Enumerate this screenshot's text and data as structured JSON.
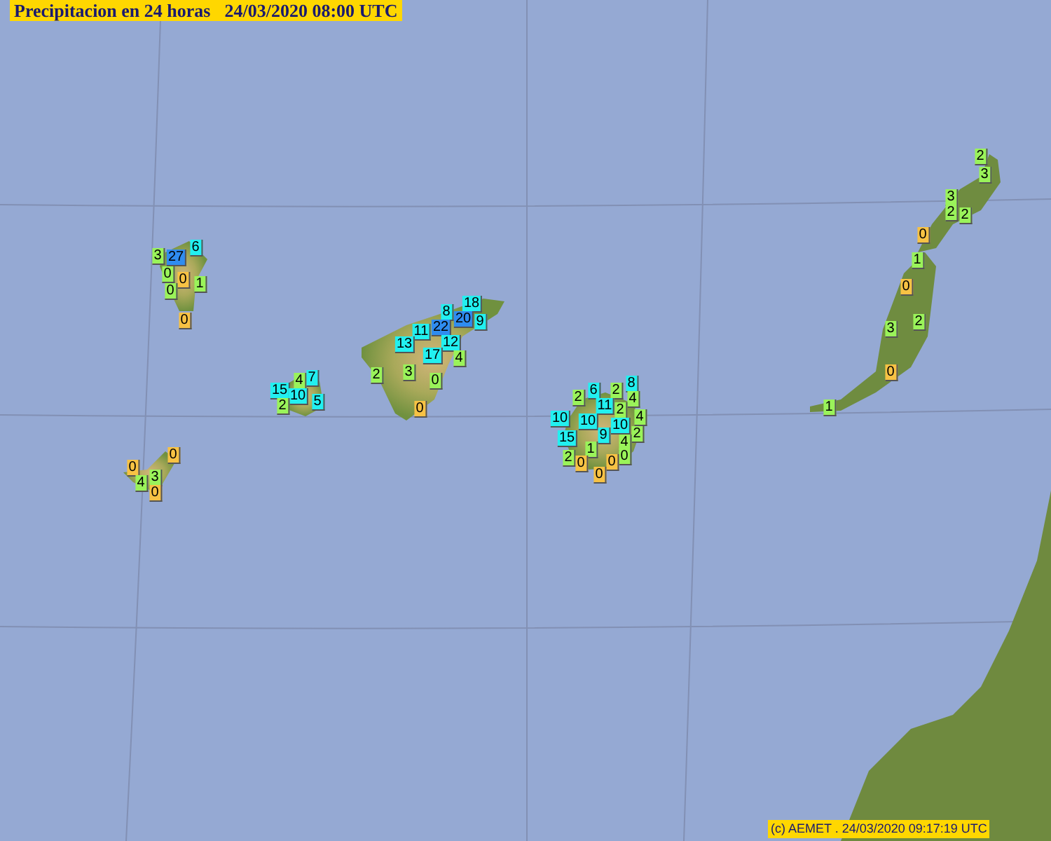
{
  "header": {
    "title": "Precipitacion en 24 horas",
    "timestamp": "24/03/2020 08:00 UTC"
  },
  "stations": [
    {
      "value": "3",
      "color": "#9af35a"
    },
    {
      "value": "27",
      "color": "#2f8cf0"
    },
    {
      "value": "6",
      "color": "#22f0f0"
    },
    {
      "value": "0",
      "color": "#9af35a"
    },
    {
      "value": "0",
      "color": "#f7c244"
    },
    {
      "value": "1",
      "color": "#9af35a"
    },
    {
      "value": "0",
      "color": "#9af35a"
    },
    {
      "value": "0",
      "color": "#f7c244"
    },
    {
      "value": "4",
      "color": "#9af35a"
    },
    {
      "value": "7",
      "color": "#22f0f0"
    },
    {
      "value": "15",
      "color": "#22f0f0"
    },
    {
      "value": "10",
      "color": "#22f0f0"
    },
    {
      "value": "2",
      "color": "#9af35a"
    },
    {
      "value": "5",
      "color": "#22f0f0"
    },
    {
      "value": "0",
      "color": "#f7c244"
    },
    {
      "value": "0",
      "color": "#f7c244"
    },
    {
      "value": "3",
      "color": "#9af35a"
    },
    {
      "value": "4",
      "color": "#9af35a"
    },
    {
      "value": "0",
      "color": "#f7c244"
    },
    {
      "value": "18",
      "color": "#22f0f0"
    },
    {
      "value": "8",
      "color": "#22f0f0"
    },
    {
      "value": "20",
      "color": "#2f8cf0"
    },
    {
      "value": "9",
      "color": "#22f0f0"
    },
    {
      "value": "11",
      "color": "#22f0f0"
    },
    {
      "value": "22",
      "color": "#2f8cf0"
    },
    {
      "value": "13",
      "color": "#22f0f0"
    },
    {
      "value": "12",
      "color": "#22f0f0"
    },
    {
      "value": "17",
      "color": "#22f0f0"
    },
    {
      "value": "4",
      "color": "#9af35a"
    },
    {
      "value": "2",
      "color": "#9af35a"
    },
    {
      "value": "3",
      "color": "#9af35a"
    },
    {
      "value": "0",
      "color": "#9af35a"
    },
    {
      "value": "0",
      "color": "#f7c244"
    },
    {
      "value": "2",
      "color": "#9af35a"
    },
    {
      "value": "6",
      "color": "#22f0f0"
    },
    {
      "value": "2",
      "color": "#9af35a"
    },
    {
      "value": "8",
      "color": "#22f0f0"
    },
    {
      "value": "4",
      "color": "#9af35a"
    },
    {
      "value": "11",
      "color": "#22f0f0"
    },
    {
      "value": "2",
      "color": "#9af35a"
    },
    {
      "value": "10",
      "color": "#22f0f0"
    },
    {
      "value": "10",
      "color": "#22f0f0"
    },
    {
      "value": "4",
      "color": "#9af35a"
    },
    {
      "value": "10",
      "color": "#22f0f0"
    },
    {
      "value": "2",
      "color": "#9af35a"
    },
    {
      "value": "15",
      "color": "#22f0f0"
    },
    {
      "value": "9",
      "color": "#22f0f0"
    },
    {
      "value": "4",
      "color": "#9af35a"
    },
    {
      "value": "1",
      "color": "#9af35a"
    },
    {
      "value": "2",
      "color": "#9af35a"
    },
    {
      "value": "0",
      "color": "#9af35a"
    },
    {
      "value": "0",
      "color": "#f7c244"
    },
    {
      "value": "0",
      "color": "#f7c244"
    },
    {
      "value": "0",
      "color": "#f7c244"
    },
    {
      "value": "2",
      "color": "#9af35a"
    },
    {
      "value": "3",
      "color": "#9af35a"
    },
    {
      "value": "3",
      "color": "#9af35a"
    },
    {
      "value": "2",
      "color": "#9af35a"
    },
    {
      "value": "2",
      "color": "#9af35a"
    },
    {
      "value": "0",
      "color": "#f7c244"
    },
    {
      "value": "1",
      "color": "#9af35a"
    },
    {
      "value": "0",
      "color": "#f7c244"
    },
    {
      "value": "2",
      "color": "#9af35a"
    },
    {
      "value": "3",
      "color": "#9af35a"
    },
    {
      "value": "0",
      "color": "#f7c244"
    },
    {
      "value": "1",
      "color": "#9af35a"
    }
  ],
  "footer": {
    "credit": "(c) AEMET . 24/03/2020 09:17:19 UTC"
  }
}
